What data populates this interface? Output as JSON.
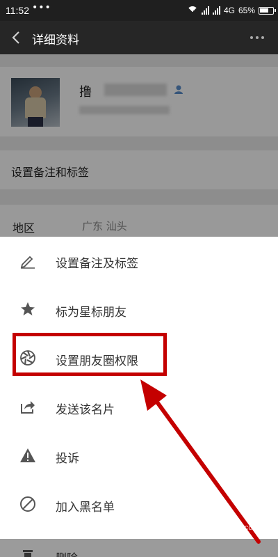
{
  "status_bar": {
    "time": "11:52",
    "dots": "•••",
    "network": "4G",
    "battery": "65%"
  },
  "title_bar": {
    "title": "详细资料"
  },
  "profile": {
    "name": "撸"
  },
  "rows": {
    "remark": "设置备注和标签",
    "region_label": "地区",
    "region_value": "广东  汕头"
  },
  "menu": {
    "items": [
      {
        "label": "设置备注及标签",
        "icon": "pencil-icon"
      },
      {
        "label": "标为星标朋友",
        "icon": "star-icon"
      },
      {
        "label": "设置朋友圈权限",
        "icon": "moments-aperture-icon"
      },
      {
        "label": "发送该名片",
        "icon": "share-icon"
      },
      {
        "label": "投诉",
        "icon": "warning-icon"
      },
      {
        "label": "加入黑名单",
        "icon": "block-icon"
      }
    ],
    "delete_label": "删除"
  },
  "annotation": {
    "color": "#c40000",
    "watermark": "jingyan.baidu.com"
  }
}
